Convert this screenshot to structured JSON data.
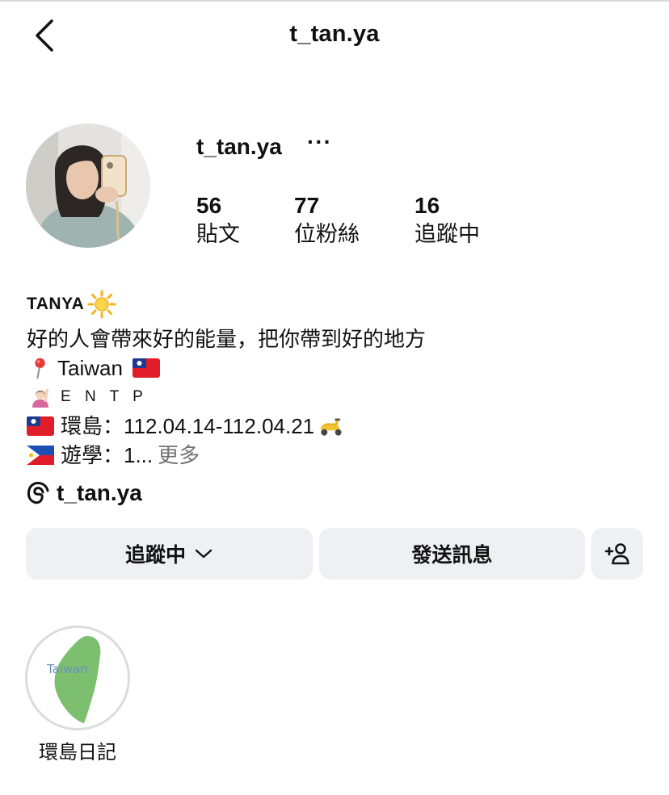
{
  "header": {
    "title": "t_tan.ya",
    "back_icon": "chevron-left-icon"
  },
  "profile": {
    "username": "t_tan.ya",
    "more_label": "···",
    "stats": [
      {
        "count": "56",
        "label": "貼文"
      },
      {
        "count": "77",
        "label": "位粉絲"
      },
      {
        "count": "16",
        "label": "追蹤中"
      }
    ]
  },
  "bio": {
    "name": "TANYA",
    "name_emoji": "sun",
    "lines": [
      {
        "text": "好的人會帶來好的能量，把你帶到好的地方"
      },
      {
        "icon": "pin",
        "text": "Taiwan",
        "trailing_icon": "taiwan-flag"
      },
      {
        "icon": "raising-hand",
        "text": "E N T P"
      },
      {
        "icon": "taiwan-flag",
        "text": "環島：112.04.14-112.04.21",
        "trailing_icon": "scooter"
      },
      {
        "icon": "philippines-flag",
        "text": "遊學：1...",
        "more": "更多"
      }
    ]
  },
  "threads": {
    "handle": "t_tan.ya",
    "icon": "threads-icon"
  },
  "actions": {
    "following_label": "追蹤中",
    "message_label": "發送訊息",
    "add_person_icon": "add-person-icon"
  },
  "highlights": [
    {
      "title": "環島日記",
      "cover_text": "Taiwan",
      "cover_color": "#7cc06f"
    }
  ],
  "colors": {
    "button_bg": "#eff0f3",
    "muted_text": "#737373",
    "text": "#111111"
  }
}
